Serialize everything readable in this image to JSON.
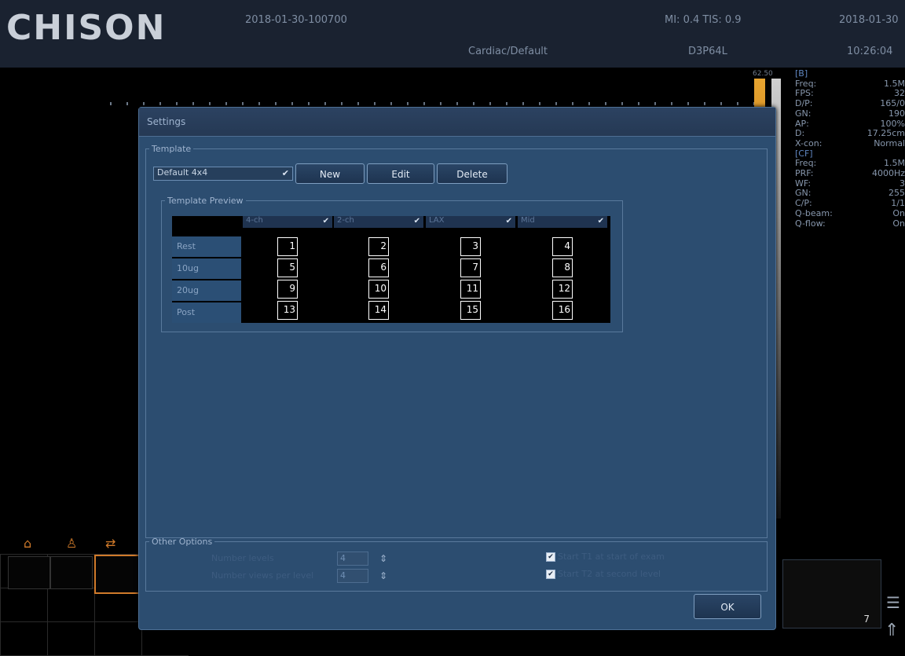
{
  "header": {
    "logo": "CHISON",
    "exam_id": "2018-01-30-100700",
    "preset": "Cardiac/Default",
    "mi_tis": "MI: 0.4  TIS: 0.9",
    "probe": "D3P64L",
    "date": "2018-01-30",
    "time": "10:26:04",
    "depth_marker": "62.50"
  },
  "params": {
    "b_title": "[B]",
    "b": [
      {
        "k": "Freq:",
        "v": "1.5M"
      },
      {
        "k": "FPS:",
        "v": "32"
      },
      {
        "k": "D/P:",
        "v": "165/0"
      },
      {
        "k": "GN:",
        "v": "190"
      },
      {
        "k": "AP:",
        "v": "100%"
      },
      {
        "k": "D:",
        "v": "17.25cm"
      },
      {
        "k": "X-con:",
        "v": "Normal"
      }
    ],
    "cf_title": "[CF]",
    "cf": [
      {
        "k": "Freq:",
        "v": "1.5M"
      },
      {
        "k": "PRF:",
        "v": "4000Hz"
      },
      {
        "k": "WF:",
        "v": "3"
      },
      {
        "k": "GN:",
        "v": "255"
      },
      {
        "k": "C/P:",
        "v": "1/1"
      },
      {
        "k": "Q-beam:",
        "v": "On"
      },
      {
        "k": "Q-flow:",
        "v": "On"
      }
    ]
  },
  "dialog": {
    "title": "Settings",
    "template_legend": "Template",
    "template_select": "Default 4x4",
    "btn_new": "New",
    "btn_edit": "Edit",
    "btn_delete": "Delete",
    "preview_legend": "Template Preview",
    "columns": [
      "4-ch",
      "2-ch",
      "LAX",
      "Mid"
    ],
    "rows": [
      "Rest",
      "10ug",
      "20ug",
      "Post"
    ],
    "cells": [
      [
        "1",
        "2",
        "3",
        "4"
      ],
      [
        "5",
        "6",
        "7",
        "8"
      ],
      [
        "9",
        "10",
        "11",
        "12"
      ],
      [
        "13",
        "14",
        "15",
        "16"
      ]
    ],
    "other_legend": "Other Options",
    "opt1_label": "Number levels",
    "opt1_value": "4",
    "opt2_label": "Number views per level",
    "opt2_value": "4",
    "check1": "Start T1 at start of exam",
    "check2": "Start T2 at second level",
    "ok": "OK"
  },
  "right_thumb_number": "7"
}
